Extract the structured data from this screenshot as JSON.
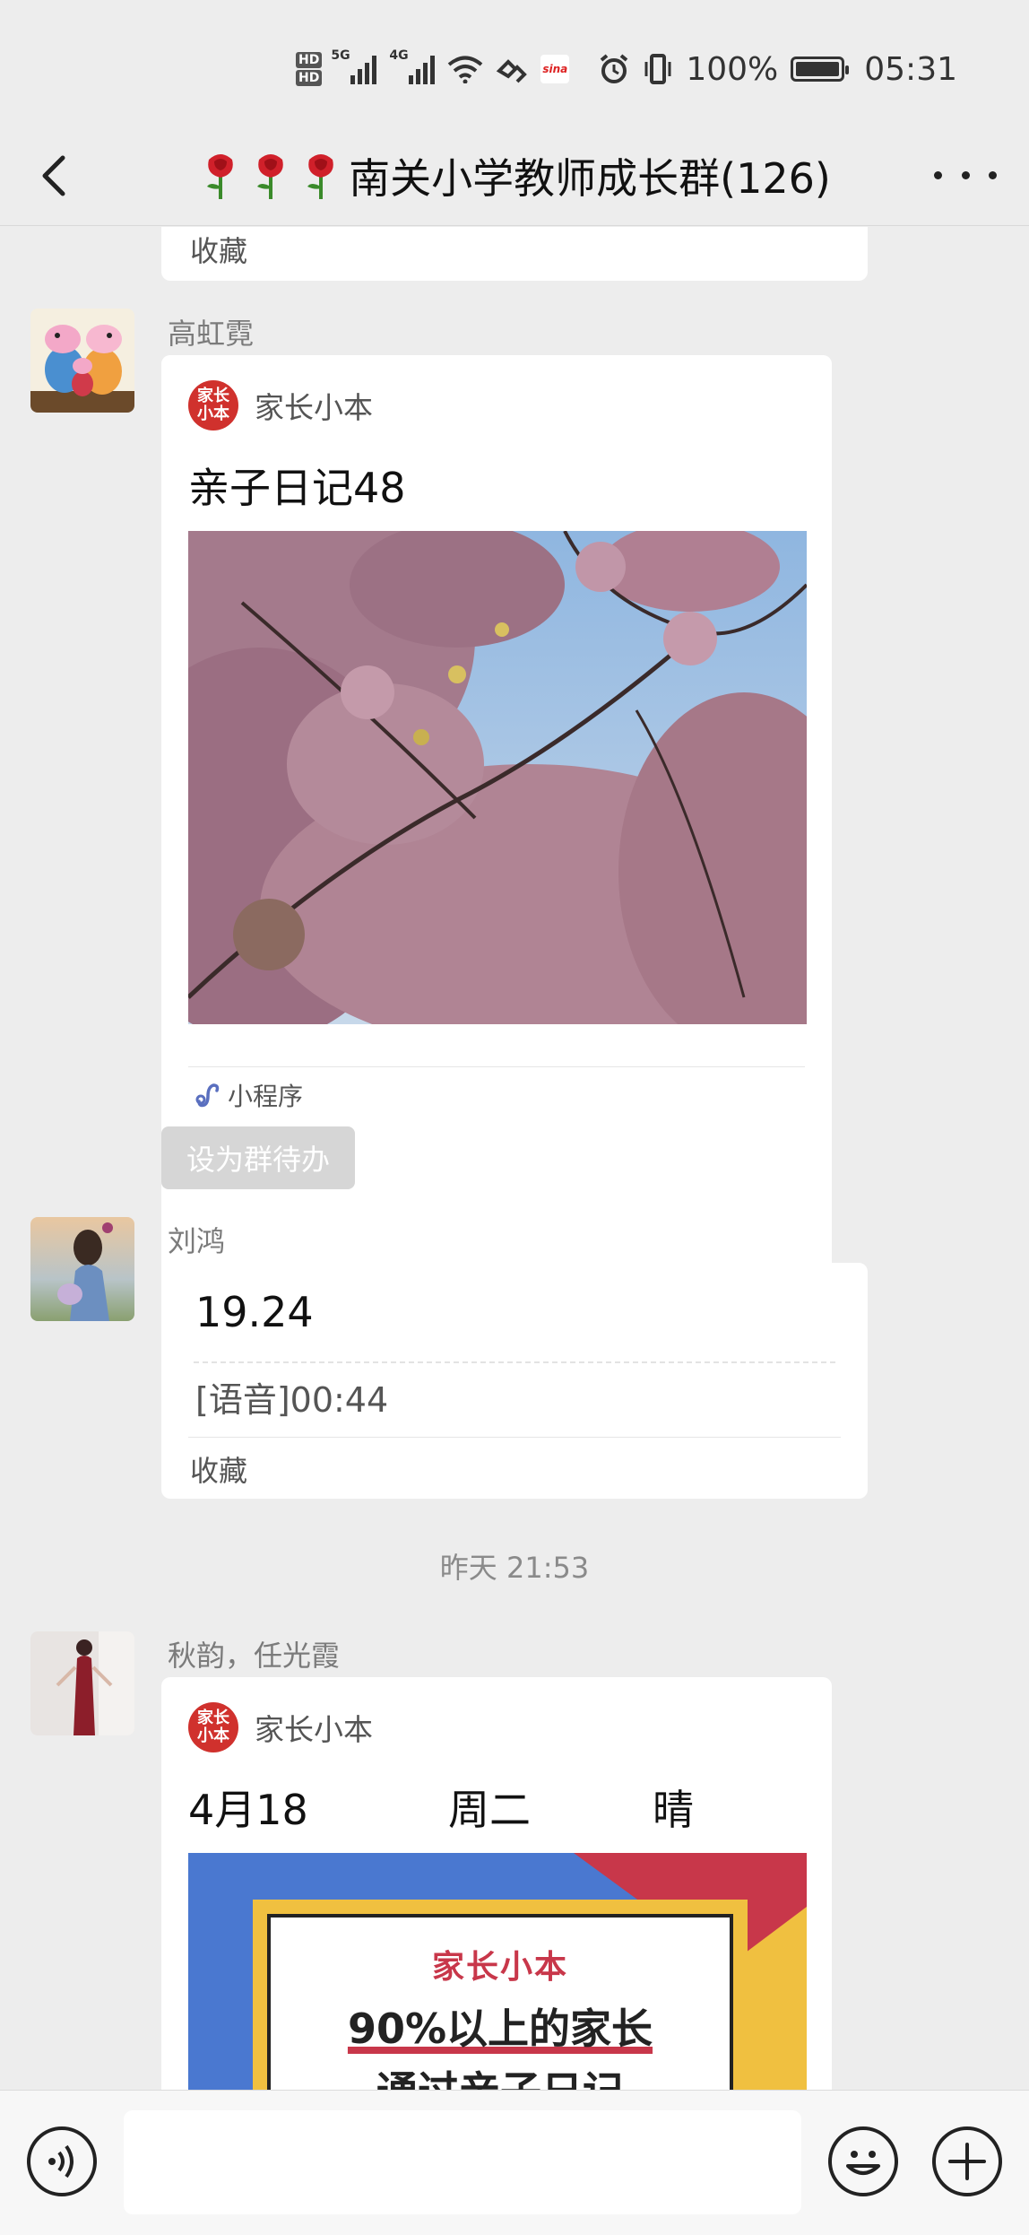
{
  "status_bar": {
    "network_5g": "5G",
    "network_4g": "4G",
    "sina": "sina",
    "battery_percent": "100%",
    "time": "05:31"
  },
  "nav": {
    "title": "南关小学教师成长群(126)",
    "title_emoji_icon": "rose-icon"
  },
  "messages": {
    "prev_collect": {
      "label": "收藏"
    },
    "msg1": {
      "sender": "高虹霓",
      "app_name": "家长小本",
      "app_logo_text": "家长小本",
      "title": "亲子日记48",
      "footer_label": "小程序",
      "todo_button": "设为群待办"
    },
    "msg2": {
      "sender": "刘鸿",
      "line1": "19.24",
      "line2": "[语音]00:44",
      "collect": "收藏"
    },
    "time_divider": "昨天 21:53",
    "msg3": {
      "sender": "秋韵，任光霞",
      "app_name": "家长小本",
      "app_logo_text": "家长小本",
      "date": "4月18",
      "weekday": "周二",
      "weather": "晴",
      "poster_brand": "家长小本",
      "poster_line1": "90%以上的家长",
      "poster_line2": "通过亲子日记"
    }
  },
  "colors": {
    "background": "#ededed",
    "bubble": "#ffffff",
    "app_logo_red": "#d0312d",
    "poster_blue": "#4a78d0",
    "poster_red": "#c8374a",
    "poster_yellow": "#f0c040"
  }
}
